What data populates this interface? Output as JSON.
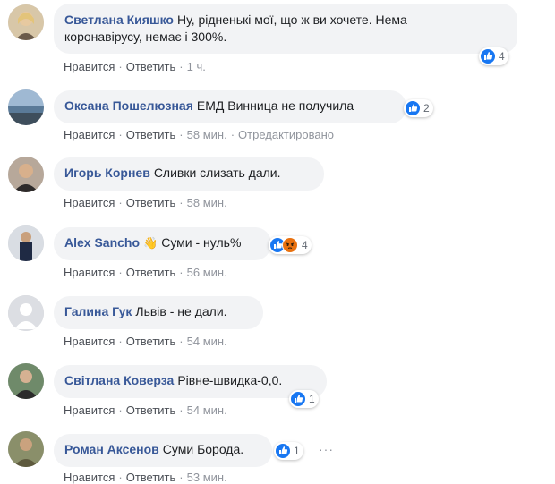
{
  "actions": {
    "like": "Нравится",
    "reply": "Ответить",
    "edited": "Отредактировано"
  },
  "more_label": "···",
  "comments": [
    {
      "author": "Светлана Кияшко",
      "text_line1": "Ну, рідненькі мої, що ж ви хочете. Нема",
      "text_line2": "коронавірусу, немає і 300%.",
      "time": "1 ч.",
      "reactions": "4"
    },
    {
      "author": "Оксана Пошелюзная",
      "text": "ЕМД Винница не получила",
      "time": "58 мин.",
      "reactions": "2"
    },
    {
      "author": "Игорь Корнев",
      "text": "Сливки слизать дали.",
      "time": "58 мин."
    },
    {
      "author": "Alex Sancho",
      "emoji": "👋",
      "text": "Суми - нуль%",
      "time": "56 мин.",
      "reactions": "4"
    },
    {
      "author": "Галина Гук",
      "text": "Львів - не дали.",
      "time": "54 мин."
    },
    {
      "author": "Світлана Коверза",
      "text": "Рівне-швидка-0,0.",
      "time": "54 мин.",
      "reactions": "1"
    },
    {
      "author": "Роман Аксенов",
      "text": "Суми Борода.",
      "time": "53 мин.",
      "reactions": "1"
    }
  ],
  "colors": {
    "author": "#385898",
    "bubble": "#f2f3f5",
    "like": "#1877f2",
    "angry": "#e9710f",
    "meta": "#90949c"
  },
  "icons": [
    "like-icon",
    "angry-icon",
    "wave-emoji",
    "more-icon"
  ]
}
